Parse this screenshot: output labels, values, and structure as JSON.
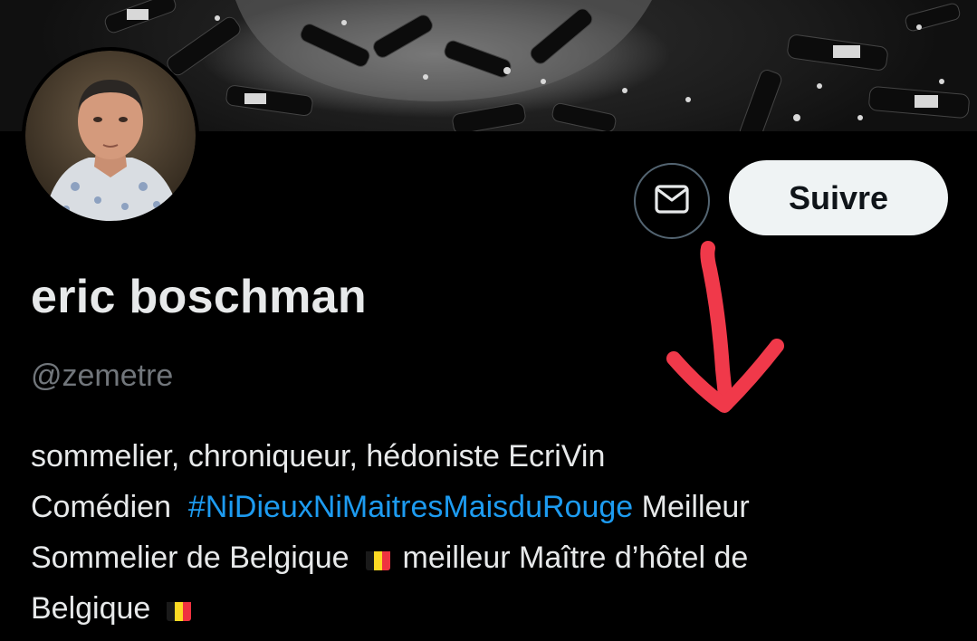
{
  "profile": {
    "display_name": "eric boschman",
    "handle": "@zemetre",
    "follow_label": "Suivre"
  },
  "bio": {
    "line1": "sommelier, chroniqueur, hédoniste EcriVin",
    "line2_start": "Comédien  ",
    "hashtag": "#NiDieuxNiMaitresMaisduRouge",
    "line2_end": " Meilleur",
    "line3_start": "Sommelier de Belgique",
    "line3_end": "meilleur Maître d’hôtel de",
    "line4": "Belgique"
  },
  "icons": {
    "message": "envelope-icon",
    "flag": "belgian-flag-emoji",
    "annotation": "red-arrow-down"
  },
  "colors": {
    "background": "#000000",
    "hashtag": "#1d9bf0",
    "handle": "#71767b",
    "follow_button_bg": "#eff3f4",
    "annotation_arrow": "#f0394a"
  }
}
